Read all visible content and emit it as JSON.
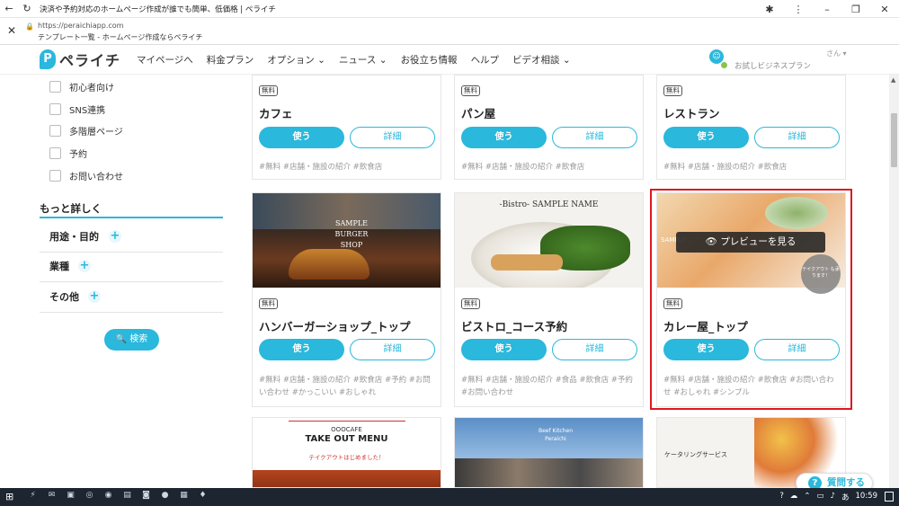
{
  "browser": {
    "tab_title": "決済や予約対応のホームページ作成が誰でも簡単、低価格 | ペライチ",
    "url": "https://peraichiapp.com",
    "page_subtitle": "テンプレート一覧 - ホームページ作成ならペライチ"
  },
  "site": {
    "logo_text": "ペライチ",
    "logo_letter": "P",
    "nav": [
      "マイページへ",
      "料金プラン",
      "オプション ⌄",
      "ニュース ⌄",
      "お役立ち情報",
      "ヘルプ",
      "ビデオ相談 ⌄"
    ],
    "plan_label": "お試しビジネスプラン",
    "user_label": "さん ▾"
  },
  "sidebar": {
    "checkboxes": [
      "初心者向け",
      "SNS連携",
      "多階層ページ",
      "予約",
      "お問い合わせ"
    ],
    "more_title": "もっと詳しく",
    "filters": [
      "用途・目的",
      "業種",
      "その他"
    ],
    "plus_symbol": "+",
    "search_label": "🔍 検索"
  },
  "cards": {
    "free_badge": "無料",
    "use_label": "使う",
    "detail_label": "詳細",
    "row1": [
      {
        "title": "カフェ",
        "tags": "#無料 #店舗・施設の紹介 #飲食店"
      },
      {
        "title": "パン屋",
        "tags": "#無料 #店舗・施設の紹介 #飲食店"
      },
      {
        "title": "レストラン",
        "tags": "#無料 #店舗・施設の紹介 #飲食店"
      }
    ],
    "row2": [
      {
        "title": "ハンバーガーショップ_トップ",
        "tags": "#無料 #店舗・施設の紹介 #飲食店 #予約 #お問い合わせ #かっこいい #おしゃれ",
        "thumb_text": "SAMPLE BURGER SHOP"
      },
      {
        "title": "ビストロ_コース予約",
        "tags": "#無料 #店舗・施設の紹介 #食品 #飲食店 #予約 #お問い合わせ",
        "thumb_text": "-Bistro- SAMPLE NAME"
      },
      {
        "title": "カレー屋_トップ",
        "tags": "#無料 #店舗・施設の紹介 #飲食店 #お問い合わせ #おしゃれ #シンプル",
        "thumb_text": "SAMPLE"
      }
    ],
    "row3": [
      {
        "thumb_title": "OOOCAFE",
        "thumb_sub": "TAKE OUT MENU",
        "thumb_note": "テイクアウトはじめました！"
      },
      {
        "thumb_text": "Beef Kitchen Peraichi"
      },
      {
        "thumb_text": "ケータリングサービス"
      }
    ],
    "preview_label": "👁 プレビューを見る",
    "takeout_badge": "テイクアウト も承ります！"
  },
  "help": {
    "label": "質問する",
    "icon": "?"
  },
  "taskbar": {
    "time": "10:59",
    "ime": "あ"
  },
  "colors": {
    "accent": "#2ab8dc",
    "highlight": "#e0181e"
  }
}
